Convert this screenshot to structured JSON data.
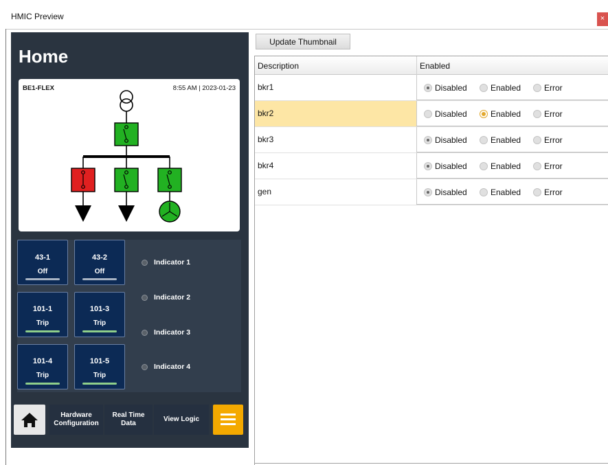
{
  "window": {
    "title": "HMIC Preview",
    "close_glyph": "×"
  },
  "hmi": {
    "page_title": "Home",
    "oneline": {
      "device": "BE1-FLEX",
      "timestamp": "8:55 AM | 2023-01-23"
    },
    "tiles": [
      {
        "name": "43-1",
        "state": "Off",
        "indicator_color": "#a8b4c4"
      },
      {
        "name": "43-2",
        "state": "Off",
        "indicator_color": "#a8b4c4"
      },
      {
        "name": "101-1",
        "state": "Trip",
        "indicator_color": "#8fcf8a"
      },
      {
        "name": "101-3",
        "state": "Trip",
        "indicator_color": "#8fcf8a"
      },
      {
        "name": "101-4",
        "state": "Trip",
        "indicator_color": "#8fcf8a"
      },
      {
        "name": "101-5",
        "state": "Trip",
        "indicator_color": "#8fcf8a"
      }
    ],
    "indicators": [
      "Indicator 1",
      "Indicator 2",
      "Indicator 3",
      "Indicator 4"
    ],
    "nav": {
      "home_icon": "home-icon",
      "hardware_line1": "Hardware",
      "hardware_line2": "Configuration",
      "realtime_line1": "Real Time",
      "realtime_line2": "Data",
      "view_logic": "View Logic",
      "menu_icon": "menu-icon"
    },
    "colors": {
      "breaker_open": "#e02020",
      "breaker_closed": "#22b122"
    }
  },
  "toolbar": {
    "update_thumbnail": "Update Thumbnail"
  },
  "grid": {
    "columns": [
      "Description",
      "Enabled"
    ],
    "options": [
      "Disabled",
      "Enabled",
      "Error"
    ],
    "rows": [
      {
        "description": "bkr1",
        "selected": "Disabled",
        "highlighted": false
      },
      {
        "description": "bkr2",
        "selected": "Enabled",
        "highlighted": true
      },
      {
        "description": "bkr3",
        "selected": "Disabled",
        "highlighted": false
      },
      {
        "description": "bkr4",
        "selected": "Disabled",
        "highlighted": false
      },
      {
        "description": "gen",
        "selected": "Disabled",
        "highlighted": false
      }
    ]
  }
}
